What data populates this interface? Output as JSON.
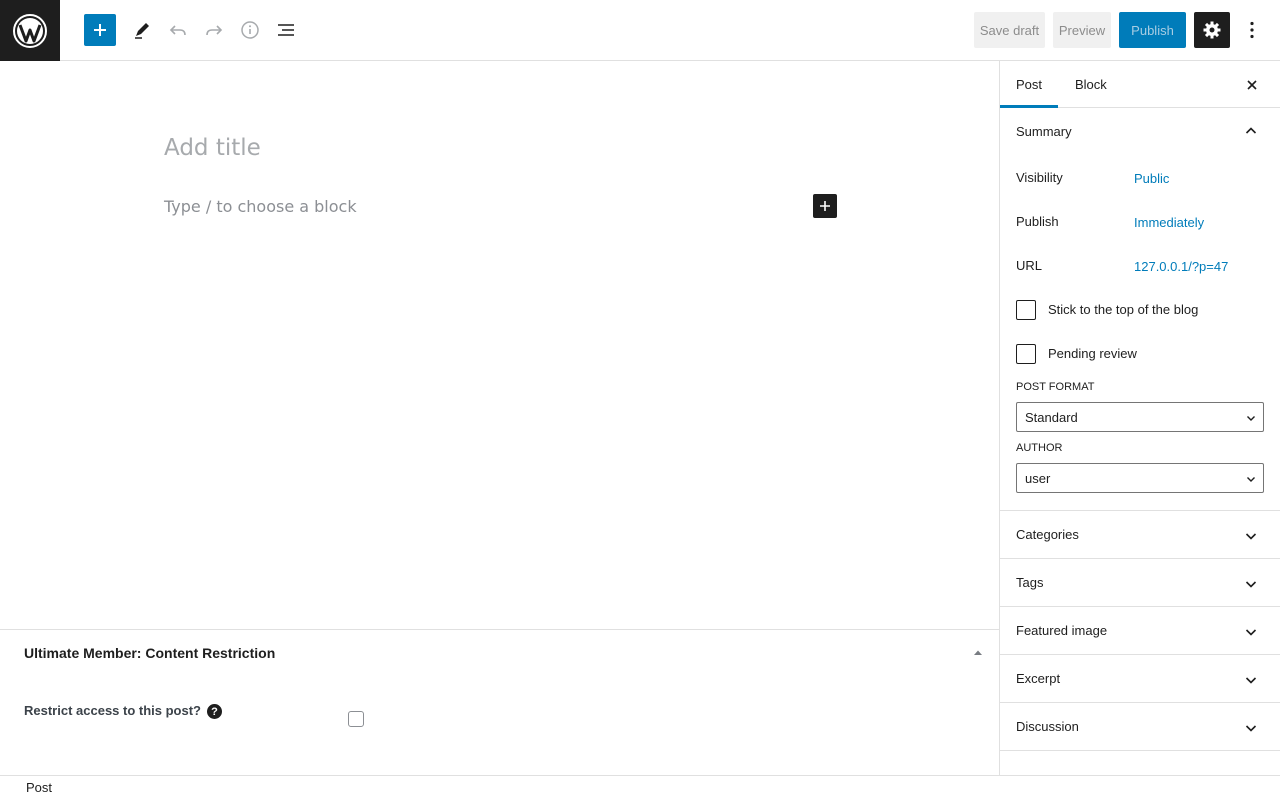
{
  "toolbar": {
    "save_draft": "Save draft",
    "preview": "Preview",
    "publish": "Publish",
    "accent": "#007cba",
    "icons": [
      "wordpress-logo-icon",
      "plus-icon",
      "pencil-icon",
      "undo-icon",
      "redo-icon",
      "info-icon",
      "list-view-icon",
      "gear-icon",
      "more-vertical-icon"
    ]
  },
  "editor": {
    "title_placeholder": "Add title",
    "block_placeholder": "Type / to choose a block"
  },
  "metabox": {
    "title": "Ultimate Member: Content Restriction",
    "restrict_label": "Restrict access to this post?",
    "help": "?"
  },
  "footer": {
    "breadcrumb": "Post"
  },
  "sidebar": {
    "tabs": [
      "Post",
      "Block"
    ],
    "summary": {
      "title": "Summary",
      "rows": [
        {
          "label": "Visibility",
          "value": "Public"
        },
        {
          "label": "Publish",
          "value": "Immediately"
        },
        {
          "label": "URL",
          "value": "127.0.0.1/?p=47"
        }
      ],
      "checkboxes": [
        "Stick to the top of the blog",
        "Pending review"
      ],
      "post_format": {
        "label": "POST FORMAT",
        "value": "Standard"
      },
      "author": {
        "label": "AUTHOR",
        "value": "user"
      }
    },
    "panels": [
      "Categories",
      "Tags",
      "Featured image",
      "Excerpt",
      "Discussion"
    ]
  }
}
